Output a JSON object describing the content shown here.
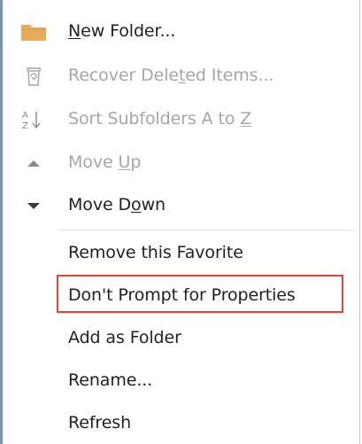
{
  "menu": {
    "items": [
      {
        "pre": "",
        "u": "N",
        "post": "ew Folder...",
        "icon": "folder-icon",
        "disabled": false
      },
      {
        "pre": "Recover Dele",
        "u": "t",
        "post": "ed Items...",
        "icon": "recycle-bin-icon",
        "disabled": true
      },
      {
        "pre": "Sort Subfolders A to ",
        "u": "Z",
        "post": "",
        "icon": "sort-az-icon",
        "disabled": true
      },
      {
        "pre": "Move ",
        "u": "U",
        "post": "p",
        "icon": "triangle-up-icon",
        "disabled": true
      },
      {
        "pre": "Move D",
        "u": "o",
        "post": "wn",
        "icon": "triangle-down-icon",
        "disabled": false
      },
      {
        "pre": "Remove this Favorite",
        "u": "",
        "post": "",
        "icon": "",
        "disabled": false
      },
      {
        "pre": "Don't Prompt for Properties",
        "u": "",
        "post": "",
        "icon": "",
        "disabled": false
      },
      {
        "pre": "Add as Folder",
        "u": "",
        "post": "",
        "icon": "",
        "disabled": false
      },
      {
        "pre": "Rename...",
        "u": "",
        "post": "",
        "icon": "",
        "disabled": false
      },
      {
        "pre": "Refresh",
        "u": "",
        "post": "",
        "icon": "",
        "disabled": false
      }
    ]
  },
  "colors": {
    "folder": "#e6ac5a",
    "disabled_text": "#a6a6a6",
    "highlight_border": "#e0443a",
    "left_border": "#7f93ab"
  }
}
